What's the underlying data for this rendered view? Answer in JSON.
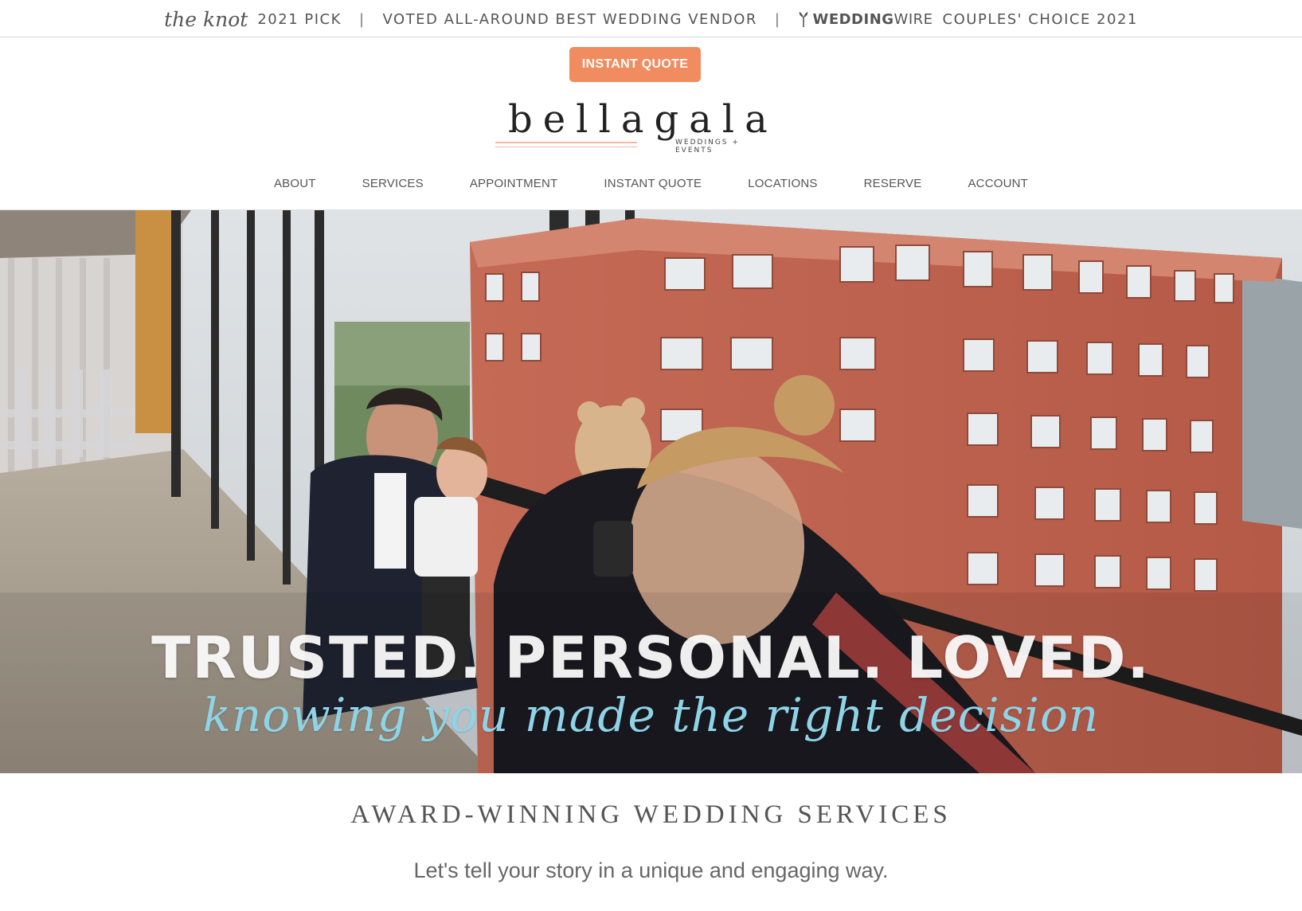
{
  "award_bar": {
    "knot_logo": "the knot",
    "knot_pick": "2021 PICK",
    "separator": "|",
    "voted": "VOTED ALL-AROUND BEST WEDDING VENDOR",
    "ww_bold": "WEDDING",
    "ww_light": "WIRE",
    "ww_choice": "COUPLES' CHOICE 2021"
  },
  "header": {
    "quote_button": "INSTANT QUOTE",
    "brand": "bellagala",
    "tagline": "WEDDINGS + EVENTS"
  },
  "nav": {
    "items": [
      {
        "label": "ABOUT"
      },
      {
        "label": "SERVICES"
      },
      {
        "label": "APPOINTMENT"
      },
      {
        "label": "INSTANT QUOTE"
      },
      {
        "label": "LOCATIONS"
      },
      {
        "label": "RESERVE"
      },
      {
        "label": "ACCOUNT"
      }
    ]
  },
  "hero": {
    "headline": "TRUSTED. PERSONAL. LOVED.",
    "script": "knowing you made the right decision"
  },
  "section": {
    "title": "AWARD-WINNING WEDDING SERVICES",
    "subtitle": "Let's tell your story in a unique and engaging way."
  },
  "colors": {
    "accent": "#f08c5f",
    "logo_line": "#f4b9a5",
    "script_text": "#8fd3e6"
  }
}
